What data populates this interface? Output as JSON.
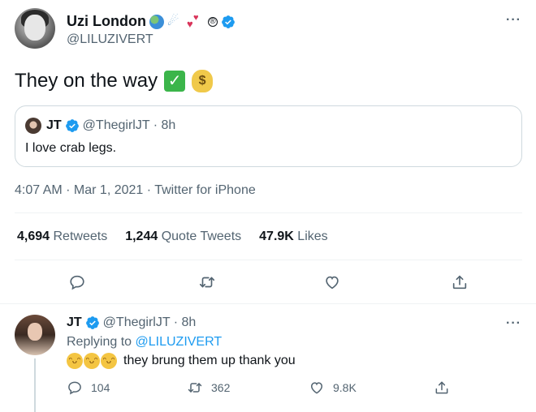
{
  "main_tweet": {
    "author_name": "Uzi London",
    "handle": "@LILUZIVERT",
    "name_emojis": [
      "globe-emoji",
      "comet-emoji",
      "hearts-emoji",
      "registered-sign"
    ],
    "registered": "®",
    "text": "They on the way",
    "text_emojis": [
      "check-mark-emoji",
      "money-bag-emoji"
    ],
    "more_label": "···",
    "timestamp": "4:07 AM · Mar 1, 2021 · Twitter for iPhone"
  },
  "quoted_tweet": {
    "author_name": "JT",
    "handle_time": "@ThegirlJT · 8h",
    "text": "I love crab legs."
  },
  "stats": [
    {
      "count": "4,694",
      "label": "Retweets"
    },
    {
      "count": "1,244",
      "label": "Quote Tweets"
    },
    {
      "count": "47.9K",
      "label": "Likes"
    }
  ],
  "actions": [
    "reply-icon",
    "retweet-icon",
    "like-icon",
    "share-icon"
  ],
  "reply": {
    "author_name": "JT",
    "handle_time": "@ThegirlJT · 8h",
    "replying_prefix": "Replying to",
    "replying_to": "@LILUZIVERT",
    "text": "they brung them up thank you",
    "more_label": "···",
    "counts": {
      "replies": "104",
      "retweets": "362",
      "likes": "9.8K"
    }
  },
  "colors": {
    "text": "#0f1419",
    "secondary": "#536471",
    "link": "#1d9bf0",
    "verified": "#1d9bf0",
    "border": "#cfd9de"
  }
}
